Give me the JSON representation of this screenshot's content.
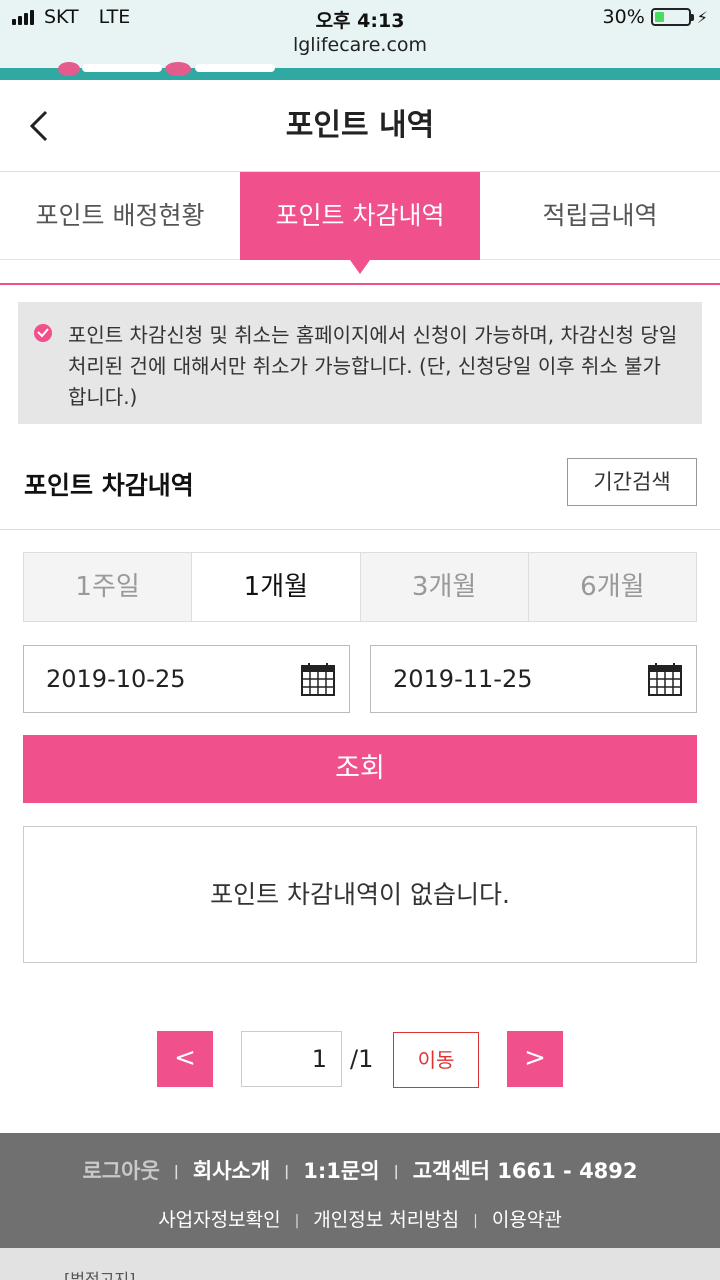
{
  "status_bar": {
    "carrier": "SKT",
    "network": "LTE",
    "time": "오후 4:13",
    "battery_percent": "30%",
    "url": "lglifecare.com"
  },
  "header": {
    "back_icon": "chevron-left-icon",
    "title": "포인트 내역"
  },
  "tabs": [
    {
      "label": "포인트 배정현황",
      "active": false
    },
    {
      "label": "포인트 차감내역",
      "active": true
    },
    {
      "label": "적립금내역",
      "active": false
    }
  ],
  "notice": {
    "icon": "check-circle-icon",
    "text": "포인트 차감신청 및 취소는 홈페이지에서 신청이 가능하며, 차감신청 당일 처리된 건에 대해서만 취소가 가능합니다. (단, 신청당일 이후 취소 불가 합니다.)"
  },
  "section": {
    "title": "포인트 차감내역",
    "period_search_label": "기간검색"
  },
  "period_options": [
    {
      "label": "1주일",
      "active": false
    },
    {
      "label": "1개월",
      "active": true
    },
    {
      "label": "3개월",
      "active": false
    },
    {
      "label": "6개월",
      "active": false
    }
  ],
  "date_range": {
    "start": "2019-10-25",
    "end": "2019-11-25",
    "icon": "calendar-icon"
  },
  "search_button_label": "조회",
  "empty_message": "포인트 차감내역이 없습니다.",
  "pagination": {
    "prev_label": "<",
    "next_label": ">",
    "current_page": "1",
    "total_pages": "/1",
    "go_label": "이동"
  },
  "footer": {
    "links_row1": [
      "로그아웃",
      "회사소개",
      "1:1문의",
      "고객센터 1661 - 4892"
    ],
    "links_row2": [
      "사업자정보확인",
      "개인정보 처리방침",
      "이용약관"
    ],
    "bottom_text": "[법적고지]"
  },
  "colors": {
    "accent": "#f0508c",
    "footer_bg": "#707070",
    "notice_bg": "#e6e6e6"
  }
}
